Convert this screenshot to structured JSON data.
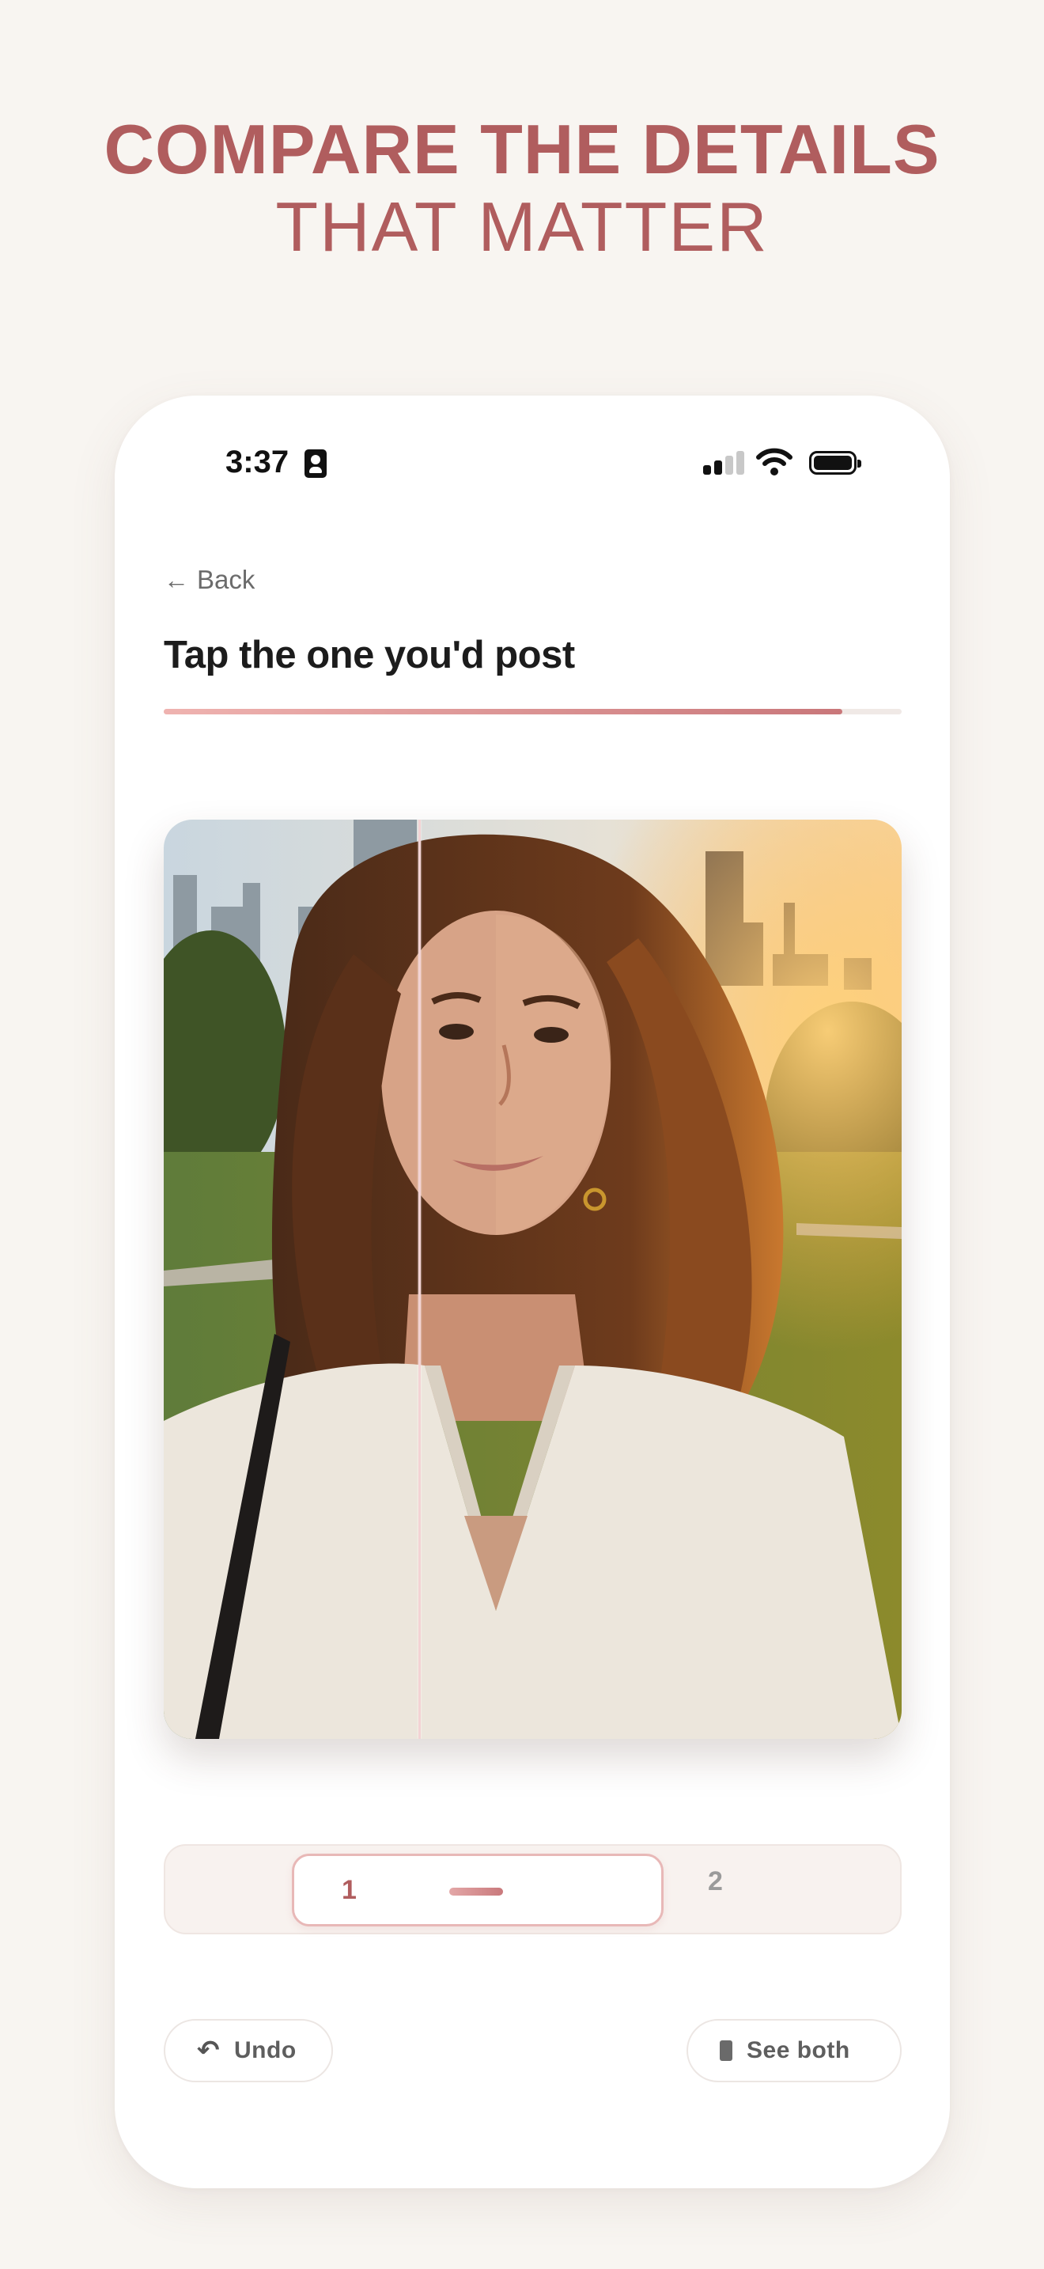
{
  "headline": {
    "line1": "COMPARE THE DETAILS",
    "line2": "THAT MATTER"
  },
  "status_bar": {
    "time": "3:37"
  },
  "nav": {
    "back_arrow": "←",
    "back_label": "Back"
  },
  "page": {
    "title": "Tap the one you'd post",
    "progress_fraction": 0.92
  },
  "photo": {
    "description_icon": "selfie-photo-compare"
  },
  "segmented": {
    "option1": "1",
    "option2": "2",
    "selected": "1"
  },
  "actions": {
    "undo_icon": "↶",
    "undo_label": "Undo",
    "see_both_label": "See both"
  },
  "colors": {
    "accent": "#b05d5e",
    "background": "#f8f5f1",
    "progress_start": "#efb3b0",
    "progress_end": "#c9777a"
  }
}
